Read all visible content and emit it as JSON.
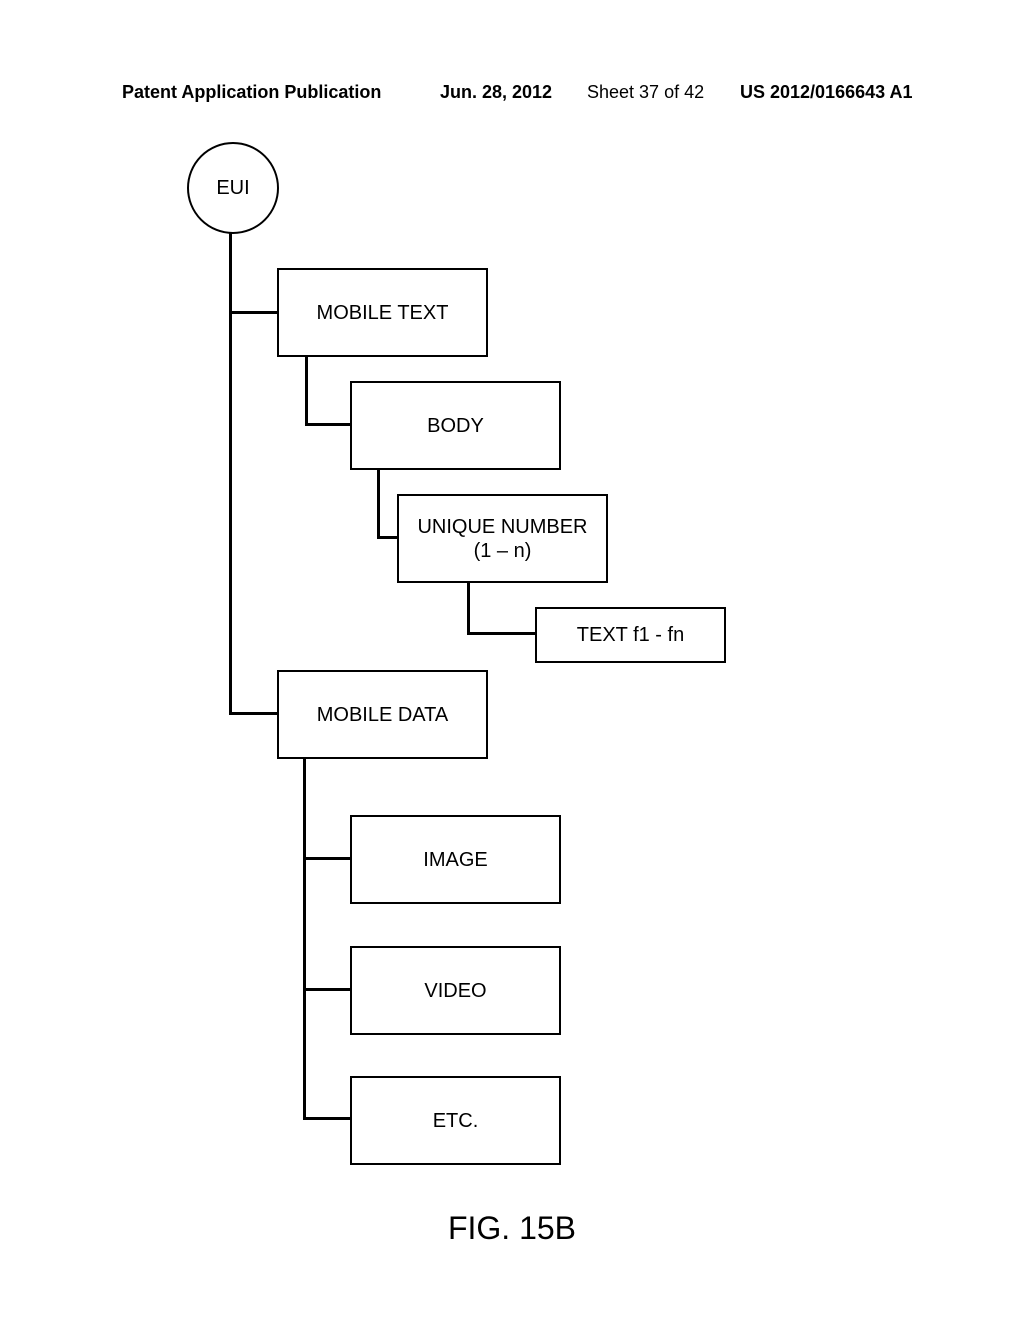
{
  "header": {
    "publication_type": "Patent Application Publication",
    "date": "Jun. 28, 2012",
    "sheet": "Sheet 37 of 42",
    "pub_number": "US 2012/0166643 A1"
  },
  "nodes": {
    "root": "EUI",
    "mobile_text": "MOBILE TEXT",
    "body": "BODY",
    "unique_number": "UNIQUE NUMBER\n(1 – n)",
    "text_fn": "TEXT f1 - fn",
    "mobile_data": "MOBILE DATA",
    "image": "IMAGE",
    "video": "VIDEO",
    "etc": "ETC."
  },
  "figure_label": "FIG. 15B"
}
